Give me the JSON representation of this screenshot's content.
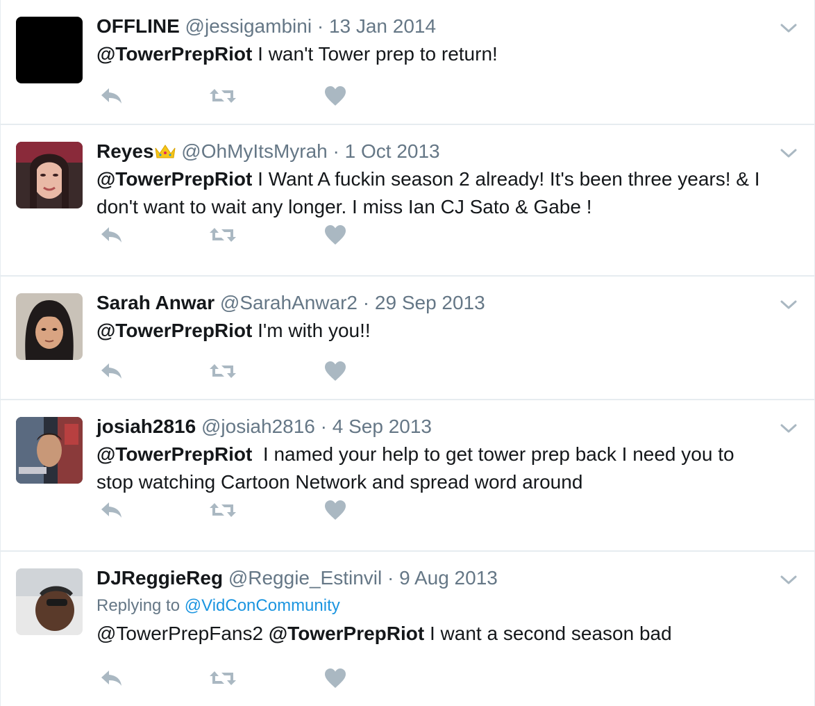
{
  "colors": {
    "name": "#14171a",
    "secondary": "#657786",
    "link": "#1b95e0",
    "icon": "#aab8c2",
    "divider": "#e6ecf0"
  },
  "icons": {
    "reply": "reply-icon",
    "retweet": "retweet-icon",
    "like": "heart-icon",
    "menu": "chevron-down-icon"
  },
  "tweets": [
    {
      "name": "OFFLINE",
      "handle": "@jessigambini",
      "separator": "·",
      "date": "13 Jan 2014",
      "mention": "@TowerPrepRiot",
      "text": " I wan't Tower prep to return!"
    },
    {
      "name": "Reyes",
      "handle": "@OhMyItsMyrah",
      "separator": "·",
      "date": "1 Oct 2013",
      "mention": "@TowerPrepRiot",
      "text": " I Want A fuckin season 2 already! It's been three years! & I don't want to wait any longer. I miss Ian CJ Sato & Gabe !"
    },
    {
      "name": "Sarah Anwar",
      "handle": "@SarahAnwar2",
      "separator": "·",
      "date": "29 Sep 2013",
      "mention": "@TowerPrepRiot",
      "text": " I'm with you!!"
    },
    {
      "name": "josiah2816",
      "handle": "@josiah2816",
      "separator": "·",
      "date": "4 Sep 2013",
      "mention": "@TowerPrepRiot",
      "text": "  I named your help to get tower prep back I need you to stop watching Cartoon Network and spread word around"
    },
    {
      "name": "DJReggieReg",
      "handle": "@Reggie_Estinvil",
      "separator": "·",
      "date": "9 Aug 2013",
      "replying_label": "Replying to ",
      "replying_to": "@VidConCommunity",
      "pre_text": "@TowerPrepFans2 ",
      "mention": "@TowerPrepRiot",
      "text": " I want a second season bad"
    }
  ]
}
